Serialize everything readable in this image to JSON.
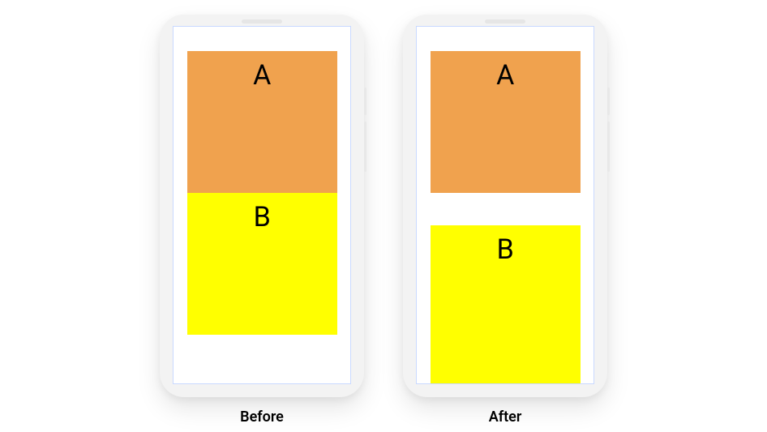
{
  "panels": [
    {
      "caption": "Before",
      "boxA": {
        "label": "A",
        "color": "#f0a24e"
      },
      "boxB": {
        "label": "B",
        "color": "#ffff00"
      }
    },
    {
      "caption": "After",
      "boxA": {
        "label": "A",
        "color": "#f0a24e"
      },
      "boxB": {
        "label": "B",
        "color": "#ffff00"
      }
    }
  ]
}
